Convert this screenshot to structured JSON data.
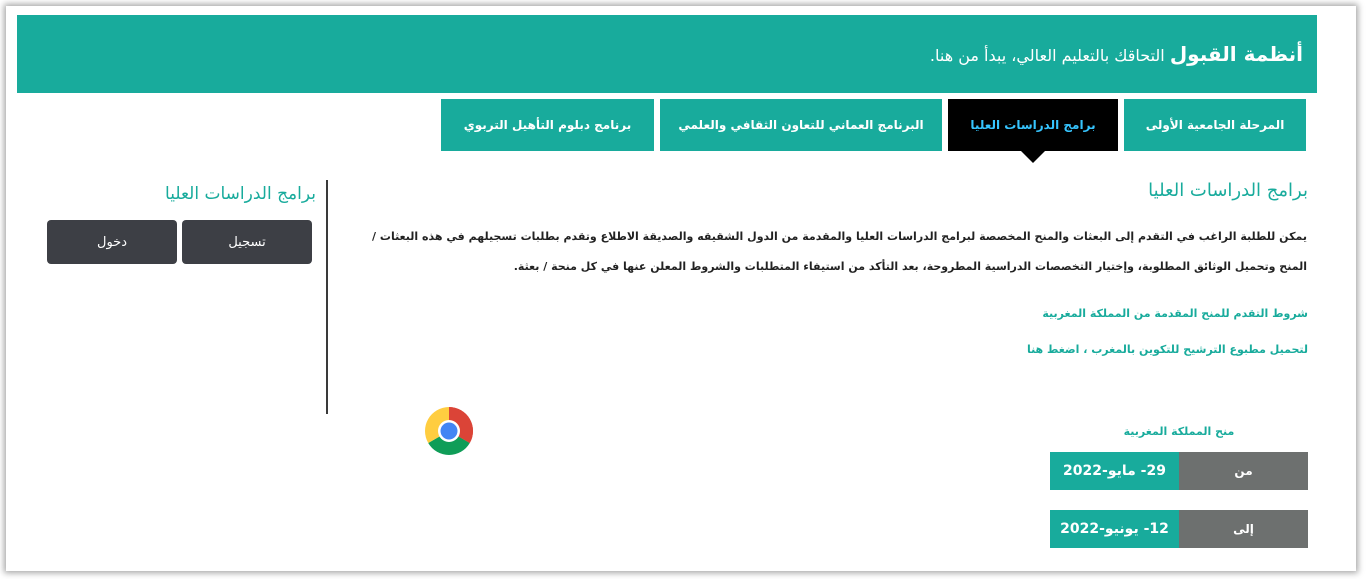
{
  "header": {
    "title_bold": "أنظمة القبول",
    "title_rest": " التحاقك بالتعليم العالي، يبدأ من هنا."
  },
  "tabs": [
    {
      "label": "المرحلة الجامعية الأولى",
      "active": false
    },
    {
      "label": "برامج الدراسات العليا",
      "active": true
    },
    {
      "label": "البرنامج العماني للتعاون الثقافي والعلمي",
      "active": false
    },
    {
      "label": "برنامج دبلوم التأهيل التربوي",
      "active": false
    }
  ],
  "main": {
    "section_title": "برامج الدراسات العليا",
    "description": "يمكن للطلبة الراغب في التقدم إلى البعثات والمنح المخصصة لبرامج الدراسات العليا والمقدمة من الدول الشقيقه والصديقة الاطلاع وتقدم بطلبات تسجيلهم في هذه البعثات / المنح وتحميل الوثائق المطلوبة، وإختيار التخصصات الدراسية المطروحة، بعد التأكد من استيفاء المتطلبات والشروط المعلن عنها في كل منحة / بعثة.",
    "link_conditions": "شروط التقدم للمنح المقدمة من المملكة المغربية",
    "link_download": "لتحميل مطبوع الترشيح للتكوين بالمغرب ، اضغط هنا"
  },
  "sidebar": {
    "title": "برامج الدراسات العليا",
    "register_label": "تسجيل",
    "login_label": "دخول"
  },
  "scholarship": {
    "caption": "منح المملكة المغربية",
    "from_label": "من",
    "from_value": "29- مايو-2022",
    "to_label": "إلى",
    "to_value": "12- يونيو-2022"
  },
  "colors": {
    "teal": "#18ab9c",
    "dark_button": "#3d3f45",
    "active_tab_bg": "#000000",
    "active_tab_text": "#36c5ff",
    "date_label_bg": "#6d706f"
  },
  "icons": {
    "browser_logo": "chrome-icon"
  }
}
